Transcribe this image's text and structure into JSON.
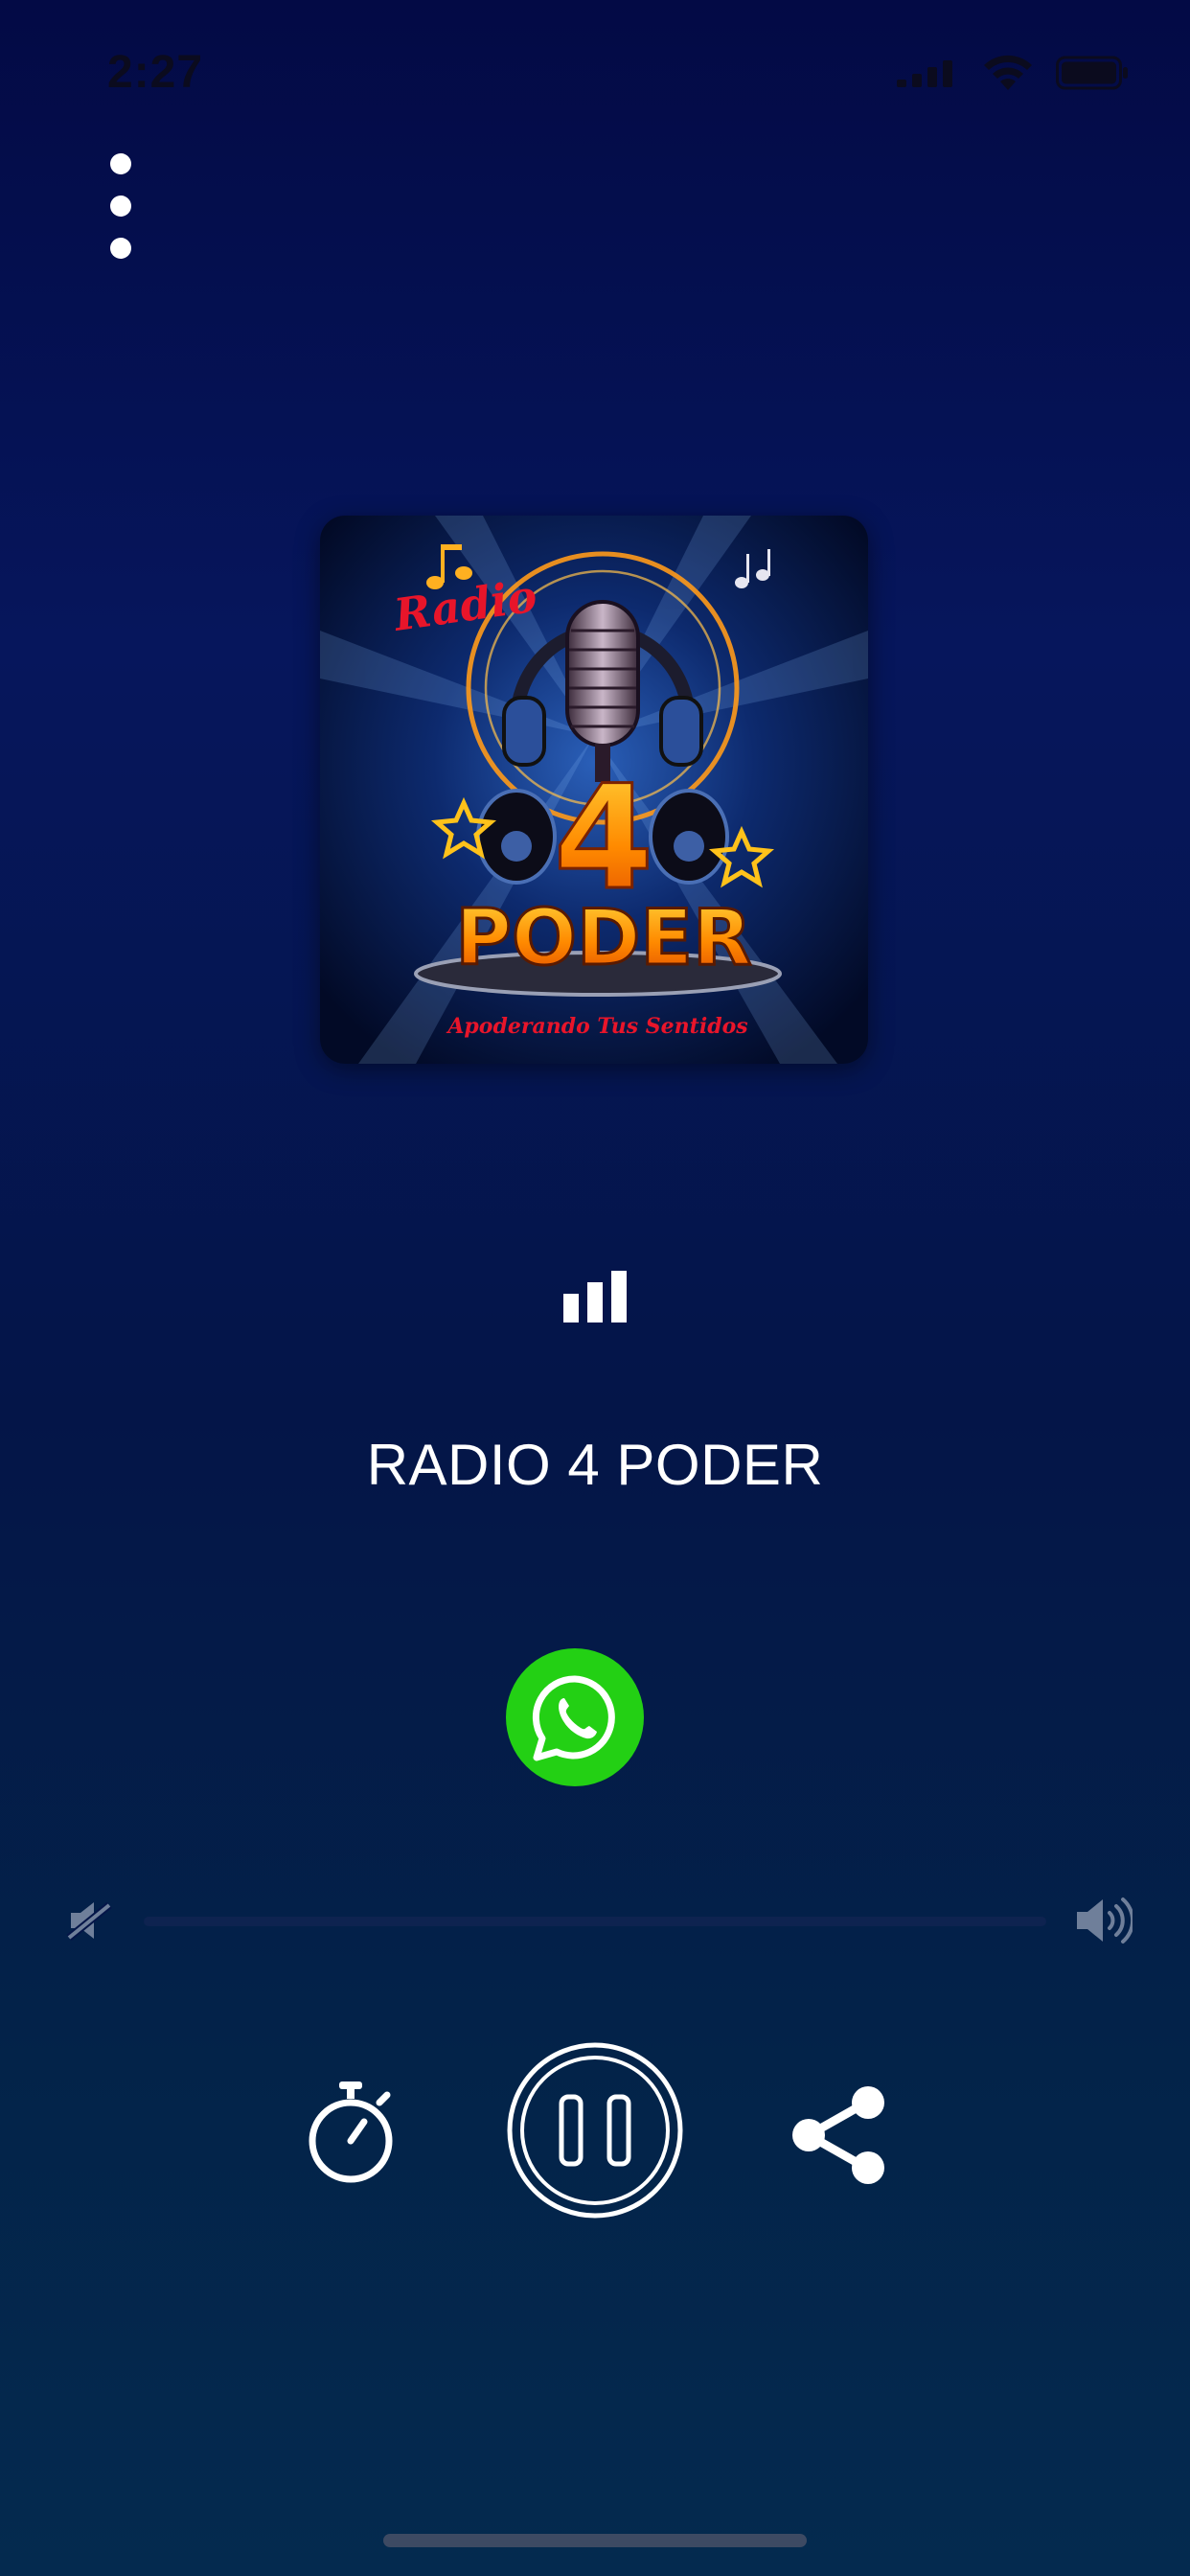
{
  "status_bar": {
    "time": "2:27",
    "icons": [
      "cellular-signal-icon",
      "wifi-icon",
      "battery-icon"
    ]
  },
  "menu": {
    "icon": "more-vertical-icon"
  },
  "artwork": {
    "logo_word_radio": "Radio",
    "logo_number": "4",
    "logo_name": "PODER",
    "logo_tagline": "Apoderando Tus Sentidos"
  },
  "now_playing": {
    "indicator_icon": "equalizer-bars-icon",
    "station_name": "RADIO 4 PODER"
  },
  "whatsapp": {
    "icon": "whatsapp-icon",
    "color": "#23d014"
  },
  "volume": {
    "min_icon": "volume-mute-icon",
    "max_icon": "volume-high-icon",
    "level": 0.0
  },
  "controls": {
    "timer_icon": "stopwatch-icon",
    "playback_icon": "pause-icon",
    "share_icon": "share-icon"
  },
  "colors": {
    "background_top": "#030a45",
    "background_bottom": "#042a4f",
    "accent_orange": "#ff8a00"
  }
}
